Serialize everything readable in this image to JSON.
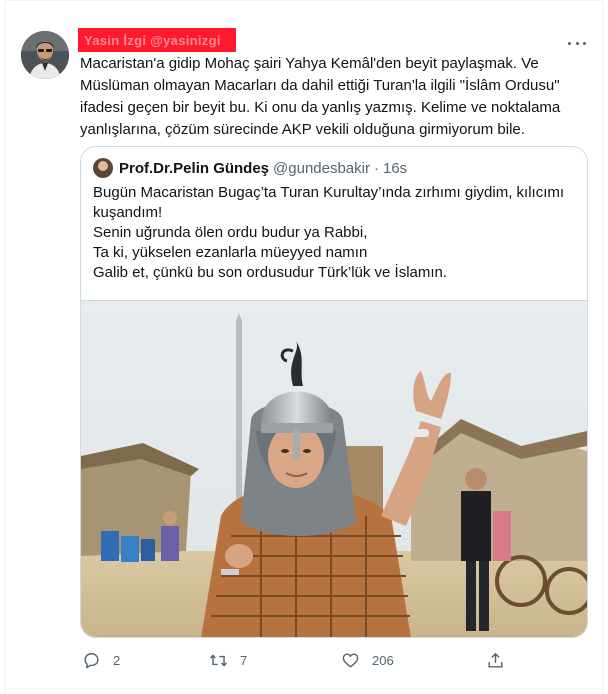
{
  "tweet": {
    "author_redacted_text": "Yasin İzgi @yasinizgi",
    "lines": [
      "Macaristan'a gidip Mohaç şairi Yahya Kemâl'den beyit paylaşmak. Ve",
      "Müslüman olmayan Macarları da dahil ettiği Turan'la ilgili \"İslâm Ordusu\"",
      "ifadesi geçen bir beyit bu. Ki onu da yanlış yazmış. Kelime ve noktalama",
      "yanlışlarına, çözüm sürecinde AKP vekili olduğuna girmiyorum bile."
    ]
  },
  "quote": {
    "name": "Prof.Dr.Pelin Gündeş",
    "handle": "@gundesbakir",
    "separator": "·",
    "time": "16s",
    "lines": [
      "Bugün Macaristan Bugaç’ta Turan Kurultay’ında zırhımı giydim, kılıcımı",
      "kuşandım!",
      "Senin uğrunda ölen ordu budur ya Rabbi,",
      "Ta ki, yükselen ezanlarla müeyyed namın",
      "Galib et, çünkü bu son ordusudur Türk’lük ve İslamın."
    ]
  },
  "actions": {
    "reply_count": "2",
    "retweet_count": "7",
    "like_count": "206"
  },
  "icons": {
    "reply": "reply-icon",
    "retweet": "retweet-icon",
    "like": "heart-icon",
    "share": "share-icon",
    "more": "more-icon"
  },
  "colors": {
    "redaction": "#ff1a2e",
    "secondary_text": "#536471",
    "border": "#cfd9de"
  }
}
